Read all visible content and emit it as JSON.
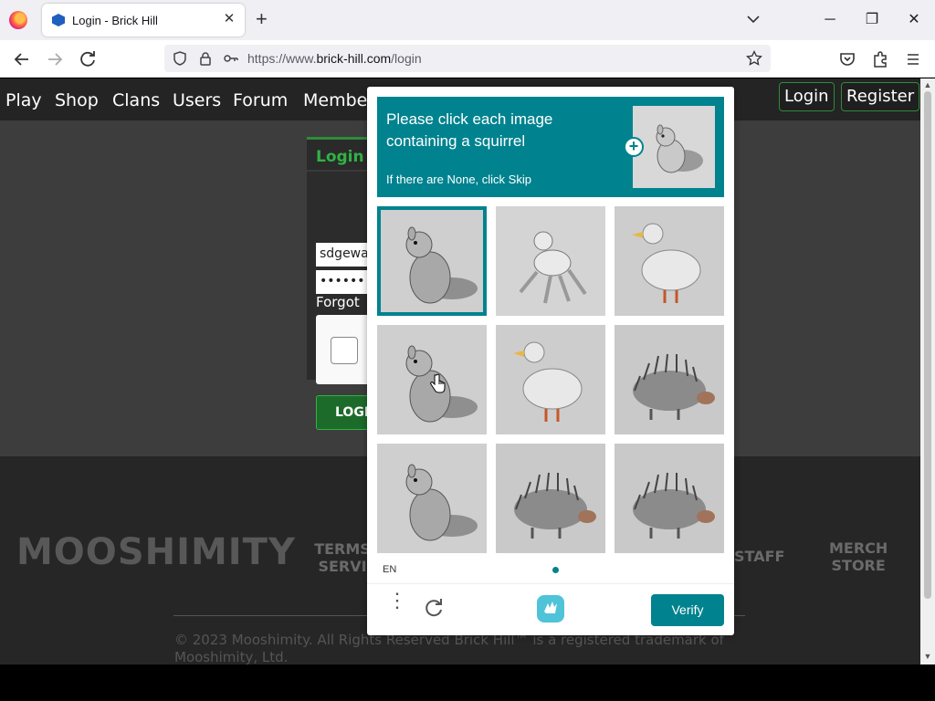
{
  "browser": {
    "tab_title": "Login - Brick Hill",
    "tab_close": "✕",
    "new_tab": "+",
    "url_prefix": "https://www.",
    "url_domain": "brick-hill.com",
    "url_path": "/login",
    "window_controls": {
      "minimize": "─",
      "restore": "❐",
      "close": "✕"
    },
    "nav_icons": [
      "back-arrow-icon",
      "forward-arrow-icon",
      "reload-icon"
    ]
  },
  "site": {
    "nav": [
      "Play",
      "Shop",
      "Clans",
      "Users",
      "Forum",
      "Membe"
    ],
    "login_button": "Login",
    "register_button": "Register",
    "login_box": {
      "title": "Login",
      "username_value": "sdgewa",
      "password_value": "••••••",
      "forgot": "Forgot",
      "submit": "LOGI"
    },
    "footer": {
      "logo": "MOOSHIMITY",
      "terms": "TERMS\nSERVI",
      "staff": "STAFF",
      "merch": "MERCH\nSTORE",
      "copyright": "© 2023 Mooshimity. All Rights Reserved Brick Hill™ is a registered trademark of Mooshimity, Ltd."
    }
  },
  "captcha": {
    "prompt": "Please click each image containing a squirrel",
    "subtext": "If there are None, click Skip",
    "example": "squirrel",
    "tiles": [
      {
        "subject": "squirrel",
        "selected": true
      },
      {
        "subject": "frog",
        "selected": false
      },
      {
        "subject": "duck",
        "selected": false
      },
      {
        "subject": "squirrel",
        "selected": false
      },
      {
        "subject": "duck",
        "selected": false
      },
      {
        "subject": "hedgehog",
        "selected": false
      },
      {
        "subject": "squirrel",
        "selected": false
      },
      {
        "subject": "hedgehog",
        "selected": false
      },
      {
        "subject": "hedgehog",
        "selected": false
      }
    ],
    "language": "EN",
    "verify_label": "Verify",
    "accent_color": "#00838f"
  }
}
